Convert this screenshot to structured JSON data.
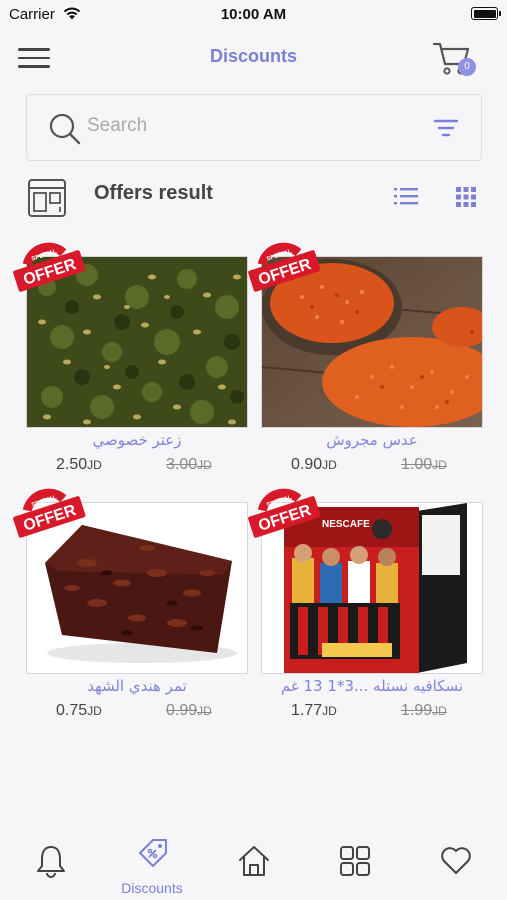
{
  "status_bar": {
    "carrier": "Carrier",
    "time": "10:00 AM"
  },
  "header": {
    "title": "Discounts",
    "cart_count": "0"
  },
  "search": {
    "placeholder": "Search"
  },
  "results": {
    "title": "Offers result"
  },
  "badge": {
    "top_text": "SPECIAL",
    "main_text": "OFFER"
  },
  "products": [
    {
      "name": "زعتر خصوصي",
      "price": "2.50",
      "old_price": "3.00",
      "currency": "JD",
      "image": "zaatar"
    },
    {
      "name": "عدس مجروش",
      "price": "0.90",
      "old_price": "1.00",
      "currency": "JD",
      "image": "lentils"
    },
    {
      "name": "تمر هندي الشهد",
      "price": "0.75",
      "old_price": "0.99",
      "currency": "JD",
      "image": "tamarind"
    },
    {
      "name": "نسكافيه نستله ...3*1 13 غم",
      "price": "1.77",
      "old_price": "1.99",
      "currency": "JD",
      "image": "nescafe"
    }
  ],
  "nescafe_box_text": "NESCAFE",
  "tabs": [
    {
      "name": "notifications",
      "label": "",
      "icon": "bell-icon"
    },
    {
      "name": "discounts",
      "label": "Discounts",
      "icon": "discount-tag-icon",
      "active": true
    },
    {
      "name": "home",
      "label": "",
      "icon": "home-icon"
    },
    {
      "name": "categories",
      "label": "",
      "icon": "grid-icon"
    },
    {
      "name": "favorites",
      "label": "",
      "icon": "heart-icon"
    }
  ],
  "colors": {
    "accent": "#7c7fd6",
    "badge_red": "#d8192a",
    "background": "#f6f6f8"
  }
}
